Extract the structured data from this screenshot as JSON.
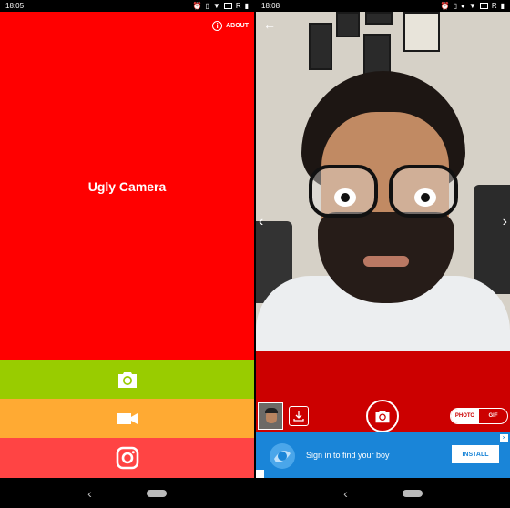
{
  "left_phone": {
    "status_time": "18:05",
    "about_label": "ABOUT",
    "app_title": "Ugly Camera",
    "colors": {
      "splash": "#ff0000",
      "photo": "#99cc00",
      "video": "#ffaa33",
      "instagram": "#ff4444"
    },
    "mode_buttons": [
      {
        "icon": "camera-icon"
      },
      {
        "icon": "video-camera-icon"
      },
      {
        "icon": "instagram-icon"
      }
    ]
  },
  "right_phone": {
    "status_time": "18:08",
    "controls_color": "#cc0000",
    "toggle": {
      "photo_label": "PHOTO",
      "gif_label": "GIF",
      "selected": "PHOTO"
    },
    "ad": {
      "text": "Sign in to find your boy",
      "install_label": "INSTALL",
      "color": "#1a85d8"
    }
  }
}
